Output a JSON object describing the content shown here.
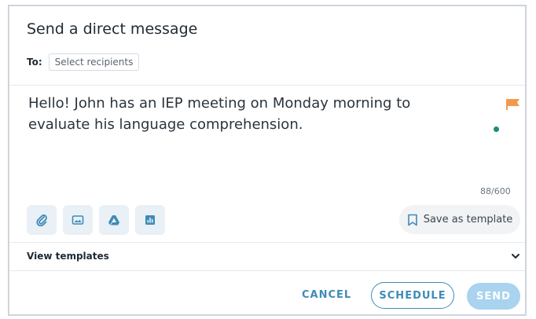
{
  "dialog": {
    "title": "Send a direct message",
    "to_label": "To:",
    "recipients_placeholder": "Select recipients"
  },
  "message": {
    "body": "Hello! John has an IEP meeting on Monday morning to evaluate his language comprehension.",
    "char_count": "88/600",
    "flag_color": "#f29a4a",
    "dot_color": "#1f8a7a"
  },
  "toolbar": {
    "icons": [
      "paperclip-icon",
      "image-icon",
      "google-drive-icon",
      "chart-icon"
    ],
    "save_template_label": "Save as template"
  },
  "templates": {
    "label": "View templates"
  },
  "actions": {
    "cancel_label": "CANCEL",
    "schedule_label": "SCHEDULE",
    "send_label": "SEND",
    "accent_color": "#3f8bb8"
  }
}
